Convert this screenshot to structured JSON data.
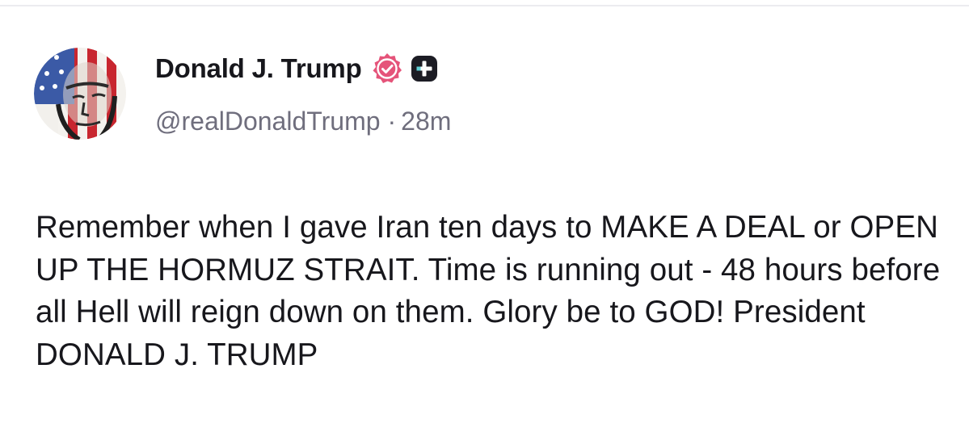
{
  "post": {
    "author": {
      "display_name": "Donald J. Trump",
      "handle": "@realDonaldTrump",
      "verified_icon": "verified-badge-icon",
      "plus_icon": "plus-badge-icon"
    },
    "separator": "·",
    "timestamp": "28m",
    "body": "Remember when I gave Iran ten days to MAKE A DEAL or OPEN UP THE HORMUZ STRAIT. Time is running out - 48 hours before all Hell will reign down on them. Glory be to GOD! President DONALD J. TRUMP"
  },
  "colors": {
    "verified_badge": "#e5547a",
    "plus_badge": "#1c1c24",
    "text_primary": "#17171c",
    "text_secondary": "#6f6e7d"
  }
}
